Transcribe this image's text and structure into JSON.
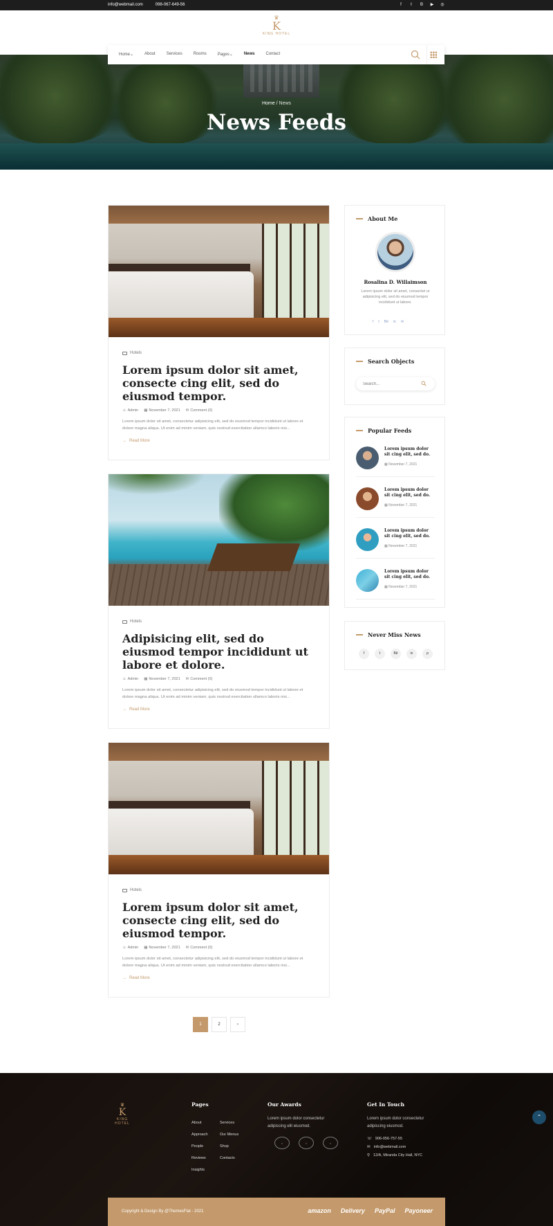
{
  "topbar": {
    "email": "info@webmail.com",
    "phone": "098-067-649-56",
    "socials": [
      "facebook-icon",
      "twitter-icon",
      "behance-icon",
      "youtube-icon",
      "instagram-icon"
    ]
  },
  "logo": {
    "letter": "K",
    "name": "KING HOTEL"
  },
  "nav": {
    "items": [
      "Home",
      "About",
      "Services",
      "Rooms",
      "Pages",
      "News",
      "Contact"
    ],
    "active": "News"
  },
  "hero": {
    "breadcrumb_home": "Home",
    "breadcrumb_sep": "/",
    "breadcrumb_current": "News",
    "title": "News Feeds"
  },
  "posts": [
    {
      "category": "Hotels",
      "title": "Lorem ipsum dolor sit amet, consecte cing elit, sed do eiusmod tempor.",
      "author": "Admin",
      "date": "November 7, 2021",
      "comments": "Comment (0)",
      "excerpt": "Lorem ipsum dolor sit amet, consectetur adipisicing elit, sed do eiusmod tempor incididunt ut labore et dolore magna aliqua. Ut enim ad minim veniam, quis nostrud exercitation ullamco laboris nisi...",
      "read_more": "Read More",
      "image": "bedroom"
    },
    {
      "category": "Hotels",
      "title": "Adipisicing elit, sed do eiusmod tempor incididunt ut labore et dolore.",
      "author": "Admin",
      "date": "November 7, 2021",
      "comments": "Comment (0)",
      "excerpt": "Lorem ipsum dolor sit amet, consectetur adipisicing elit, sed do eiusmod tempor incididunt ut labore et dolore magna aliqua. Ut enim ad minim veniam, quis nostrud exercitation ullamco laboris nisi...",
      "read_more": "Read More",
      "image": "pool"
    },
    {
      "category": "Hotels",
      "title": "Lorem ipsum dolor sit amet, consecte cing elit, sed do eiusmod tempor.",
      "author": "Admin",
      "date": "November 7, 2021",
      "comments": "Comment (0)",
      "excerpt": "Lorem ipsum dolor sit amet, consectetur adipisicing elit, sed do eiusmod tempor incididunt ut labore et dolore magna aliqua. Ut enim ad minim veniam, quis nostrud exercitation ullamco laboris nisi...",
      "read_more": "Read More",
      "image": "bedroom"
    }
  ],
  "pagination": {
    "pages": [
      "1",
      "2"
    ],
    "active": "1",
    "next": "›"
  },
  "sidebar": {
    "about": {
      "title": "About Me",
      "name": "Rosalina D. Willaimson",
      "bio": "Lorem ipsum dolor sit amet, consectet ur adipisicing elit, sed do eiusmod tempor incididunt ut labore.",
      "socials": [
        "f",
        "t",
        "Bē",
        "in",
        "✉"
      ]
    },
    "search": {
      "title": "Search Objects",
      "placeholder": "Search..."
    },
    "popular": {
      "title": "Popular Feeds",
      "items": [
        {
          "title": "Lorem ipsum dolor sit cing elit, sed do.",
          "date": "November 7, 2021"
        },
        {
          "title": "Lorem ipsum dolor sit cing elit, sed do.",
          "date": "November 7, 2021"
        },
        {
          "title": "Lorem ipsum dolor sit cing elit, sed do.",
          "date": "November 7, 2021"
        },
        {
          "title": "Lorem ipsum dolor sit cing elit, sed do.",
          "date": "November 7, 2021"
        }
      ]
    },
    "never_miss": {
      "title": "Never Miss News",
      "icons": [
        "f",
        "t",
        "Bē",
        "in",
        "p"
      ]
    }
  },
  "footer": {
    "logo_letter": "K",
    "logo_name": "KING HOTEL",
    "pages_title": "Pages",
    "pages_col1": [
      "About",
      "Approach",
      "People",
      "Reviews",
      "Insights"
    ],
    "pages_col2": [
      "Services",
      "Our Menus",
      "Shop",
      "Contacts"
    ],
    "awards_title": "Our Awards",
    "awards_text": "Lorem ipsum dolor consectetur adipiscing elit eiusmod.",
    "touch_title": "Get In Touch",
    "touch_text": "Lorem ipsum dolor consectetur adipiscing eiusmod.",
    "phone": "906-056-757-55",
    "email": "info@webmail.com",
    "address": "12/A, Miranda City Hall, NYC",
    "copyright": "Copyright & Design By @ThemesFlat - 2021",
    "brands": [
      "amazon",
      "Delivery",
      "PayPal",
      "Payoneer"
    ]
  },
  "colors": {
    "accent": "#c49a6c",
    "dark": "#1d1d1d"
  }
}
